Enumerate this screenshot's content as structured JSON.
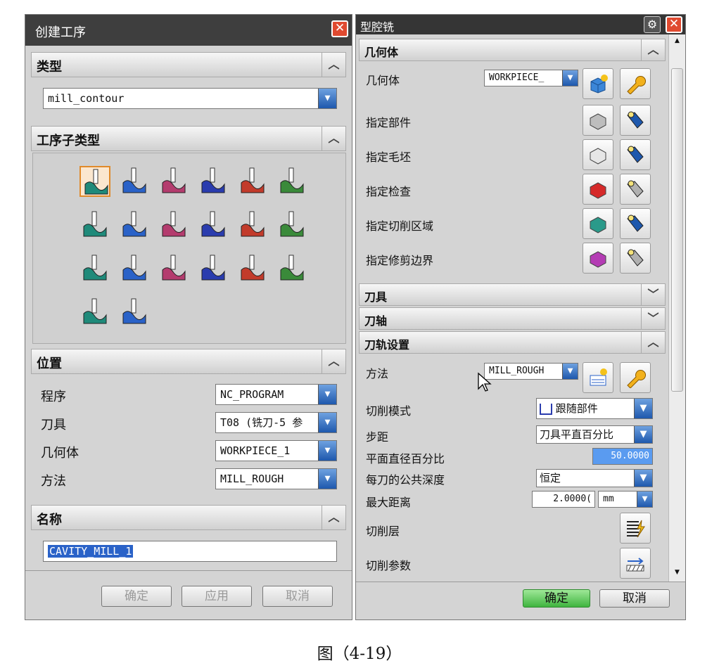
{
  "create_op": {
    "title": "创建工序",
    "close": "✕",
    "sections": {
      "type": "类型",
      "subtype": "工序子类型",
      "location": "位置",
      "name": "名称"
    },
    "type_value": "mill_contour",
    "subtypes": [
      "cavity-mill-icon",
      "plunge-mill-icon",
      "corner-rough-icon",
      "rest-mill-icon",
      "zlevel-profile-icon",
      "zlevel-corner-icon",
      "fixed-contour-icon",
      "contour-area-icon",
      "contour-surface-area-icon",
      "streamline-icon",
      "contour-area-non-steep-icon",
      "contour-area-dir-steep-icon",
      "flowcut-single-icon",
      "flowcut-multiple-icon",
      "flowcut-ref-tool-icon",
      "flowcut-smooth-icon",
      "solid-profile-3d-icon",
      "contour-text-icon",
      "mill-user-icon",
      "mill-control-icon"
    ],
    "location": [
      {
        "label": "程序",
        "value": "NC_PROGRAM"
      },
      {
        "label": "刀具",
        "value": "T08 (铣刀-5 参"
      },
      {
        "label": "几何体",
        "value": "WORKPIECE_1"
      },
      {
        "label": "方法",
        "value": "MILL_ROUGH"
      }
    ],
    "name_value": "CAVITY_MILL_1",
    "buttons": {
      "ok": "确定",
      "apply": "应用",
      "cancel": "取消"
    }
  },
  "cavity": {
    "title": "型腔铣",
    "close": "✕",
    "gear": "⚙",
    "sections": {
      "geometry": "几何体",
      "tool": "刀具",
      "axis": "刀轴",
      "path": "刀轨设置"
    },
    "geometry_label": "几何体",
    "geometry_value": "WORKPIECE_",
    "geo_rows": [
      "指定部件",
      "指定毛坯",
      "指定检查",
      "指定切削区域",
      "指定修剪边界"
    ],
    "method_label": "方法",
    "method_value": "MILL_ROUGH",
    "cut_mode_label": "切削模式",
    "cut_mode_value": "跟随部件",
    "step_label": "步距",
    "step_value": "刀具平直百分比",
    "flat_label": "平面直径百分比",
    "flat_value": "50.0000",
    "depth_label": "每刀的公共深度",
    "depth_value": "恒定",
    "max_label": "最大距离",
    "max_value": "2.0000(",
    "unit_value": "mm",
    "levels_label": "切削层",
    "params_label": "切削参数",
    "buttons": {
      "ok": "确定",
      "cancel": "取消"
    }
  },
  "caption": "图（4-19）"
}
